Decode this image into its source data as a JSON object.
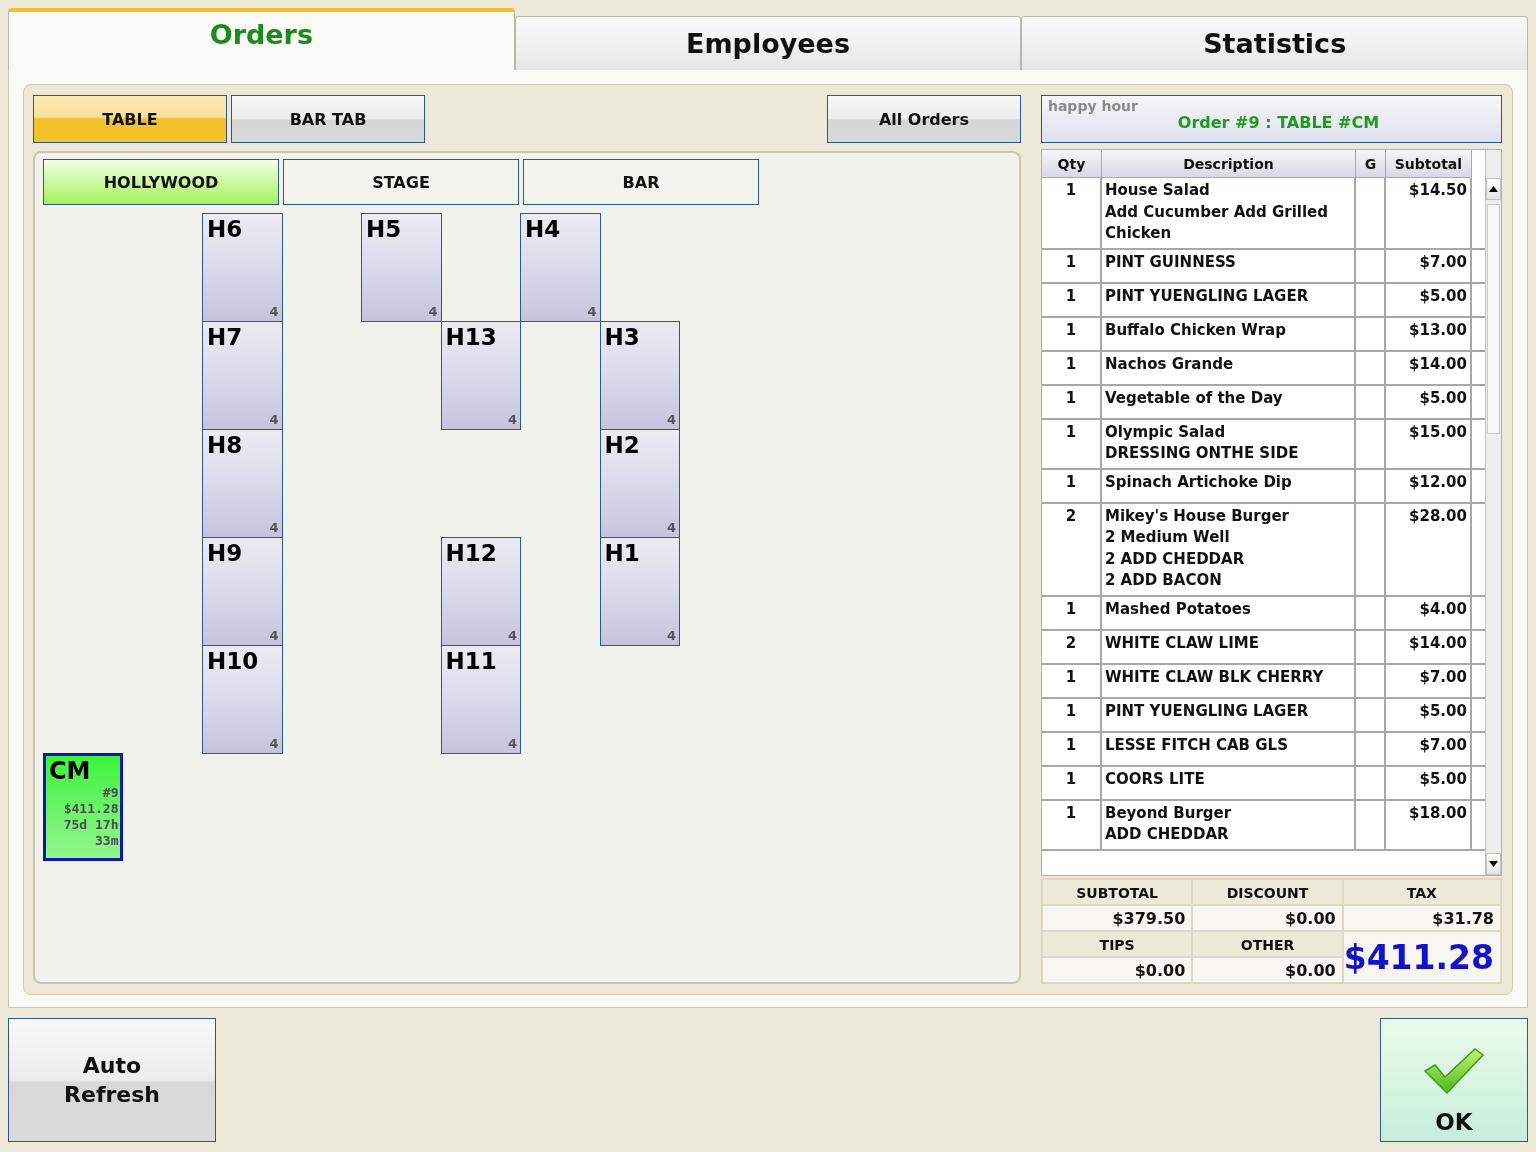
{
  "tabs": [
    {
      "label": "Orders",
      "selected": true
    },
    {
      "label": "Employees",
      "selected": false
    },
    {
      "label": "Statistics",
      "selected": false
    }
  ],
  "order_types": [
    {
      "label": "TABLE",
      "selected": true
    },
    {
      "label": "BAR TAB",
      "selected": false
    }
  ],
  "all_orders_button": "All Orders",
  "rooms": [
    {
      "label": "HOLLYWOOD",
      "selected": true
    },
    {
      "label": "STAGE",
      "selected": false
    },
    {
      "label": "BAR",
      "selected": false
    }
  ],
  "tables": [
    {
      "name": "H6",
      "seats": "4",
      "occupied": false
    },
    {
      "name": "H5",
      "seats": "4",
      "occupied": false
    },
    {
      "name": "H4",
      "seats": "4",
      "occupied": false
    },
    {
      "name": "H7",
      "seats": "4",
      "occupied": false
    },
    {
      "name": "H13",
      "seats": "4",
      "occupied": false
    },
    {
      "name": "H3",
      "seats": "4",
      "occupied": false
    },
    {
      "name": "H8",
      "seats": "4",
      "occupied": false
    },
    {
      "name": "H2",
      "seats": "4",
      "occupied": false
    },
    {
      "name": "H9",
      "seats": "4",
      "occupied": false
    },
    {
      "name": "H12",
      "seats": "4",
      "occupied": false
    },
    {
      "name": "H1",
      "seats": "4",
      "occupied": false
    },
    {
      "name": "H10",
      "seats": "4",
      "occupied": false
    },
    {
      "name": "H11",
      "seats": "4",
      "occupied": false
    },
    {
      "name": "CM",
      "occupied": true,
      "order": "#9",
      "amount": "$411.28",
      "elapsed": "75d 17h 33m"
    }
  ],
  "order": {
    "tag": "happy hour",
    "title": "Order #9 : TABLE #CM",
    "columns": [
      "Qty",
      "Description",
      "G",
      "Subtotal"
    ],
    "items": [
      {
        "qty": "1",
        "lines": [
          "House Salad",
          "Add Cucumber Add Grilled Chicken"
        ],
        "subtotal": "$14.50"
      },
      {
        "qty": "1",
        "lines": [
          "PINT GUINNESS"
        ],
        "subtotal": "$7.00"
      },
      {
        "qty": "1",
        "lines": [
          "PINT YUENGLING LAGER"
        ],
        "subtotal": "$5.00"
      },
      {
        "qty": "1",
        "lines": [
          "Buffalo Chicken Wrap"
        ],
        "subtotal": "$13.00"
      },
      {
        "qty": "1",
        "lines": [
          "Nachos Grande"
        ],
        "subtotal": "$14.00"
      },
      {
        "qty": "1",
        "lines": [
          "Vegetable of the Day"
        ],
        "subtotal": "$5.00"
      },
      {
        "qty": "1",
        "lines": [
          "Olympic Salad",
          "DRESSING ONTHE SIDE"
        ],
        "subtotal": "$15.00"
      },
      {
        "qty": "1",
        "lines": [
          "Spinach Artichoke Dip"
        ],
        "subtotal": "$12.00"
      },
      {
        "qty": "2",
        "lines": [
          "Mikey's House Burger",
          "2 Medium Well",
          "2 ADD CHEDDAR",
          "2 ADD BACON"
        ],
        "subtotal": "$28.00"
      },
      {
        "qty": "1",
        "lines": [
          "Mashed Potatoes"
        ],
        "subtotal": "$4.00"
      },
      {
        "qty": "2",
        "lines": [
          "WHITE CLAW LIME"
        ],
        "subtotal": "$14.00"
      },
      {
        "qty": "1",
        "lines": [
          "WHITE CLAW BLK CHERRY"
        ],
        "subtotal": "$7.00"
      },
      {
        "qty": "1",
        "lines": [
          "PINT YUENGLING LAGER"
        ],
        "subtotal": "$5.00"
      },
      {
        "qty": "1",
        "lines": [
          "LESSE FITCH CAB GLS"
        ],
        "subtotal": "$7.00"
      },
      {
        "qty": "1",
        "lines": [
          "COORS LITE"
        ],
        "subtotal": "$5.00"
      },
      {
        "qty": "1",
        "lines": [
          "Beyond Burger",
          "ADD CHEDDAR"
        ],
        "subtotal": "$18.00"
      }
    ]
  },
  "totals": [
    {
      "label": "SUBTOTAL",
      "value": "$379.50"
    },
    {
      "label": "DISCOUNT",
      "value": "$0.00"
    },
    {
      "label": "TAX",
      "value": "$31.78"
    },
    {
      "label": "TIPS",
      "value": "$0.00"
    },
    {
      "label": "OTHER",
      "value": "$0.00"
    }
  ],
  "grand_total": "$411.28",
  "auto_refresh_button": "Auto Refresh",
  "ok_button": "OK"
}
